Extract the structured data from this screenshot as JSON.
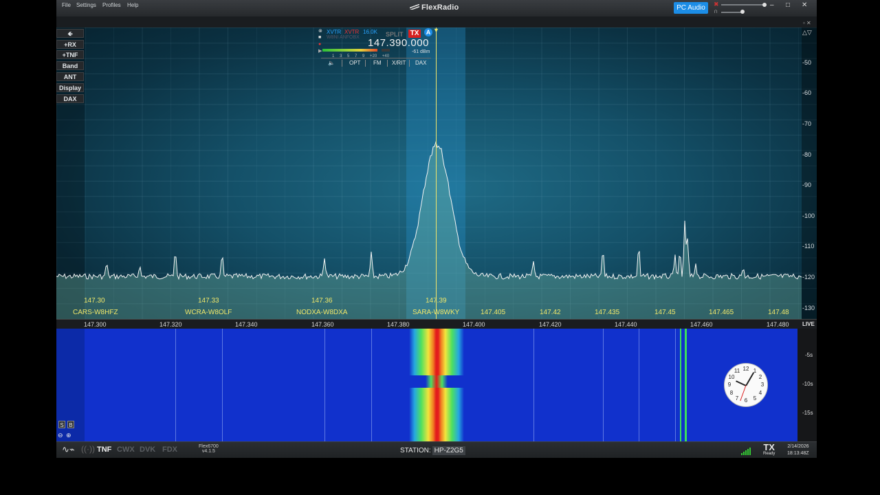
{
  "titlebar": {
    "menu": [
      "File",
      "Settings",
      "Profiles",
      "Help"
    ],
    "brand": "FlexRadio",
    "pc_audio": "PC Audio"
  },
  "sidebar": [
    "+RX",
    "+TNF",
    "Band",
    "ANT",
    "Display",
    "DAX"
  ],
  "slice": {
    "xvtr1": "XVTR",
    "xvtr2": "XVTR",
    "bandwidth": "16.0K",
    "callsign": "W8NI ANFOBX",
    "split": "SPLIT",
    "tx": "TX",
    "letter": "A",
    "frequency": "147.390.000",
    "meter_readout": "-61 dBm",
    "meter_ticks": "1 3 5 7 9 +20 +40",
    "tabs": [
      "OPT",
      "FM",
      "X/RIT",
      "DAX"
    ]
  },
  "dbm_scale": [
    "-50",
    "-60",
    "-70",
    "-80",
    "-90",
    "-100",
    "-110",
    "-120",
    "-130"
  ],
  "freq_labels": [
    "147.30",
    "147.33",
    "147.36",
    "147.39",
    "147.405",
    "147.42",
    "147.435",
    "147.45",
    "147.465",
    "147.48"
  ],
  "spots": [
    "CARS-W8HFZ",
    "WCRA-W8OLF",
    "NODXA-W8DXA",
    "SARA-W8WKY"
  ],
  "axis_labels": [
    "147.300",
    "147.320",
    "147.340",
    "147.360",
    "147.380",
    "147.400",
    "147.420",
    "147.440",
    "147.460",
    "147.480"
  ],
  "live_label": "LIVE",
  "waterfall_scale": [
    "-5s",
    "-10s",
    "-15s"
  ],
  "clock_numbers": [
    "12",
    "1",
    "2",
    "3",
    "4",
    "5",
    "6",
    "7",
    "8",
    "9",
    "10",
    "11"
  ],
  "status": {
    "tnf": "TNF",
    "cwx": "CWX",
    "dvk": "DVK",
    "fdx": "FDX",
    "model": "Flex6700",
    "version": "v4.1.5",
    "station_label": "STATION:",
    "station_value": "HP-Z2G5",
    "tx": "TX",
    "ready": "Ready",
    "date": "2/14/2026",
    "time": "18:13:48Z"
  },
  "colors": {
    "accent": "#1c8de6",
    "tx_red": "#d62020",
    "frequency_yellow": "#f0e76a",
    "waterfall_blue": "#1131cc"
  }
}
